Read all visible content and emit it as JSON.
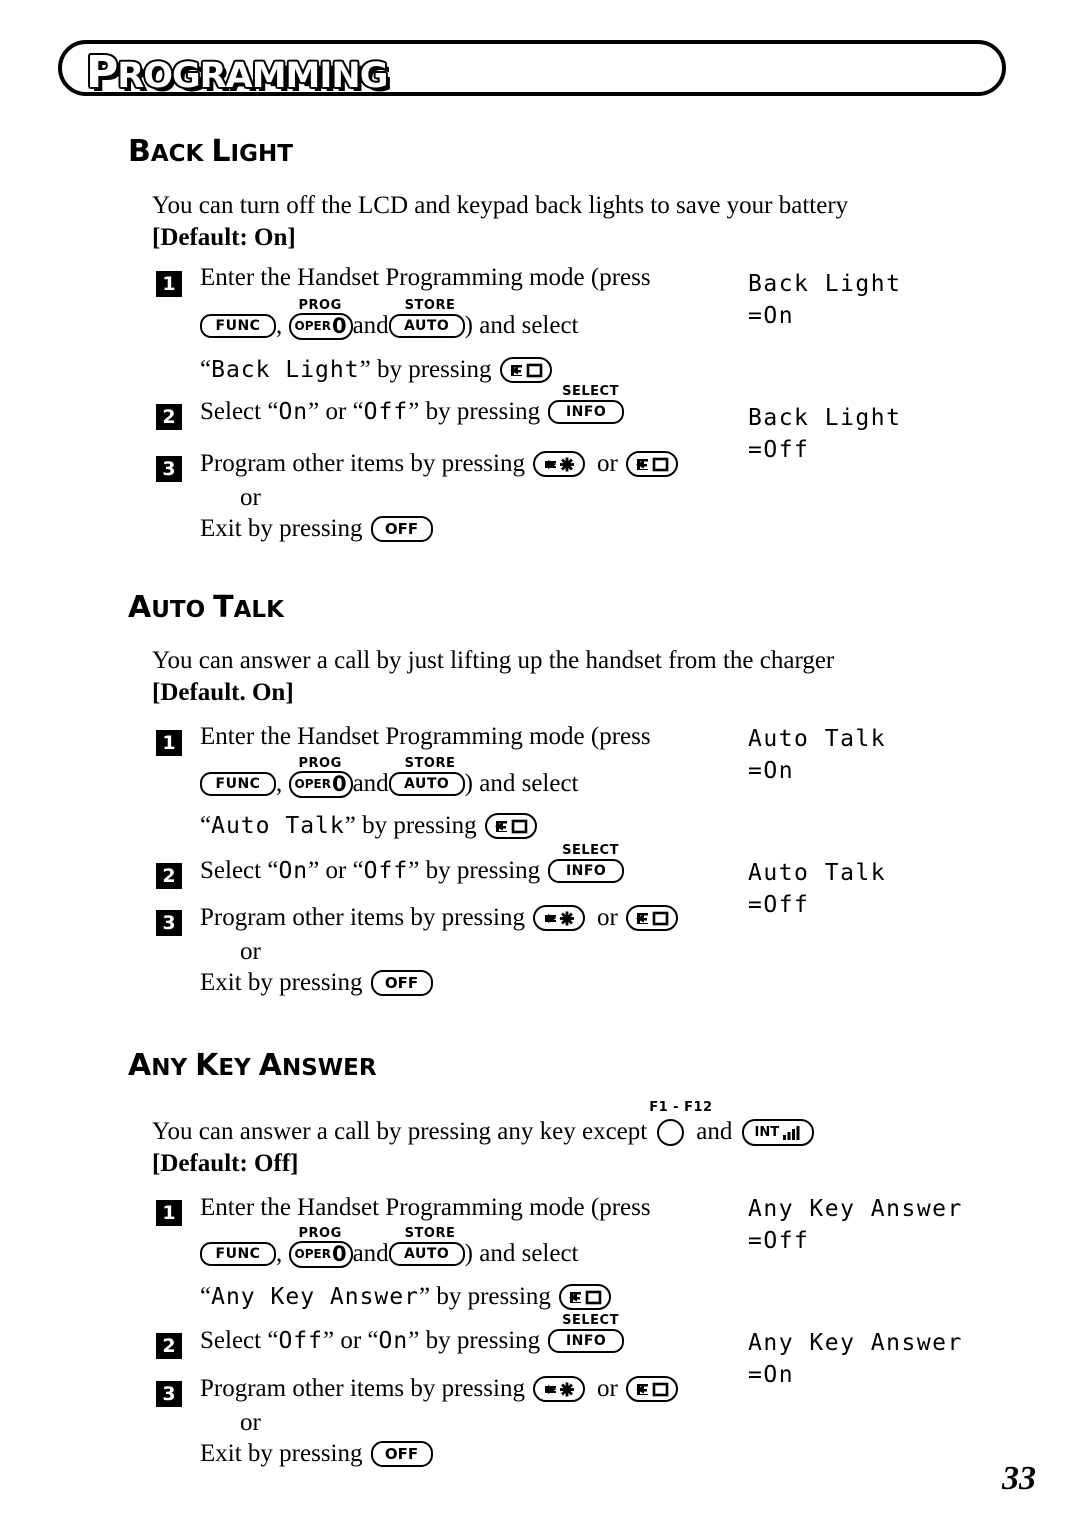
{
  "page": {
    "banner_title": "PROGRAMMING",
    "page_number": "33"
  },
  "keys": {
    "func": "FUNC",
    "oper": "OPER",
    "oper_digit": "0",
    "prog_sup": "PROG",
    "auto": "AUTO",
    "store_sup": "STORE",
    "info": "INFO",
    "select_sup": "SELECT",
    "off": "OFF",
    "int": "INT",
    "f1f12_sup": "F1 - F12"
  },
  "sections": [
    {
      "id": "back-light",
      "heading_first": "B",
      "heading_rest": "ACK ",
      "heading_first2": "L",
      "heading_rest2": "IGHT",
      "heading_full": "BACK LIGHT",
      "intro": "You can turn off the LCD and keypad back lights to save your battery",
      "default": "[Default: On]",
      "steps": [
        {
          "num": "1",
          "line1": "Enter the Handset Programming mode (press",
          "line2_mid": " and ",
          "line2_end": ") and select",
          "line3_pre": "“",
          "line3_item": "Back Light",
          "line3_post": "” by pressing"
        },
        {
          "num": "2",
          "pre": "Select “",
          "opt1": "On",
          "mid": "” or “",
          "opt2": "Off",
          "post": "” by pressing"
        },
        {
          "num": "3",
          "pre": "Program other items by pressing",
          "mid": "or",
          "or": "or",
          "exit": "Exit by pressing"
        }
      ],
      "lcd": [
        {
          "line1": "Back Light",
          "line2": "=On"
        },
        {
          "line1": "Back Light",
          "line2": "=Off"
        }
      ]
    },
    {
      "id": "auto-talk",
      "heading_full": "AUTO TALK",
      "intro": "You can answer a call by just lifting up the handset from the charger",
      "default": "[Default. On]",
      "steps": [
        {
          "num": "1",
          "line1": "Enter the Handset Programming mode (press",
          "line2_mid": " and ",
          "line2_end": ") and select",
          "line3_pre": "“",
          "line3_item": "Auto Talk",
          "line3_post": "” by pressing"
        },
        {
          "num": "2",
          "pre": "Select “",
          "opt1": "On",
          "mid": "” or “",
          "opt2": "Off",
          "post": "” by pressing"
        },
        {
          "num": "3",
          "pre": "Program other items by pressing",
          "mid": "or",
          "or": "or",
          "exit": "Exit by pressing"
        }
      ],
      "lcd": [
        {
          "line1": "Auto Talk",
          "line2": "=On"
        },
        {
          "line1": "Auto Talk",
          "line2": "=Off"
        }
      ]
    },
    {
      "id": "any-key-answer",
      "heading_full": "ANY KEY ANSWER",
      "intro_pre": "You can answer a call by pressing any key except",
      "intro_mid": "and",
      "default": "[Default: Off]",
      "steps": [
        {
          "num": "1",
          "line1": "Enter the Handset Programming mode (press",
          "line2_mid": " and ",
          "line2_end": ") and select",
          "line3_pre": "“",
          "line3_item": "Any Key Answer",
          "line3_post": "” by pressing"
        },
        {
          "num": "2",
          "pre": "Select “",
          "opt1": "Off",
          "mid": "” or “",
          "opt2": "On",
          "post": "” by pressing"
        },
        {
          "num": "3",
          "pre": "Program other items by pressing",
          "mid": "or",
          "or": "or",
          "exit": "Exit by pressing"
        }
      ],
      "lcd": [
        {
          "line1": "Any Key Answer",
          "line2": "=Off"
        },
        {
          "line1": "Any Key Answer",
          "line2": "=On"
        }
      ]
    }
  ]
}
